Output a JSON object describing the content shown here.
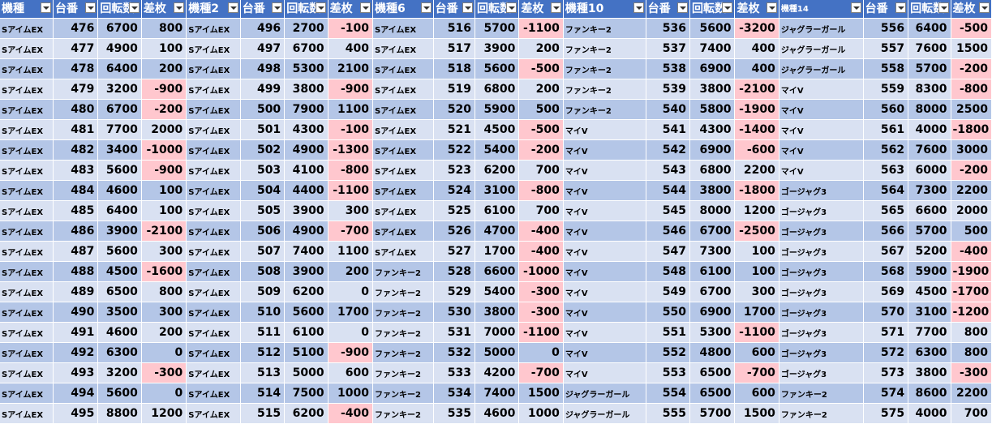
{
  "headers": [
    "機種",
    "台番",
    "回転数",
    "差枚",
    "機種2",
    "台番",
    "回転数",
    "差枚",
    "機種6",
    "台番",
    "回転数",
    "差枚",
    "機種10",
    "台番",
    "回転数",
    "差枚",
    "機種14",
    "台番",
    "回転数",
    "差枚"
  ],
  "header_display": [
    "機種",
    "台番",
    "回転数",
    "差枚",
    "機種2",
    "台番",
    "回転数",
    "差枚",
    "機種6",
    "台番",
    "回転数",
    "差枚",
    "機種10",
    "台番",
    "回転数",
    "差枚",
    "機種14",
    "台番",
    "回転数",
    "差枚"
  ],
  "rows": [
    [
      "SアイムEX",
      "476",
      "6700",
      "800",
      "SアイムEX",
      "496",
      "2700",
      "-100",
      "SアイムEX",
      "516",
      "5700",
      "-1100",
      "ファンキー2",
      "536",
      "5600",
      "-3200",
      "ジャグラーガール",
      "556",
      "6400",
      "-500"
    ],
    [
      "SアイムEX",
      "477",
      "4900",
      "100",
      "SアイムEX",
      "497",
      "6700",
      "400",
      "SアイムEX",
      "517",
      "3900",
      "200",
      "ファンキー2",
      "537",
      "7400",
      "400",
      "ジャグラーガール",
      "557",
      "7600",
      "1500"
    ],
    [
      "SアイムEX",
      "478",
      "6400",
      "200",
      "SアイムEX",
      "498",
      "5300",
      "2100",
      "SアイムEX",
      "518",
      "5600",
      "-500",
      "ファンキー2",
      "538",
      "6900",
      "400",
      "ジャグラーガール",
      "558",
      "5700",
      "-200"
    ],
    [
      "SアイムEX",
      "479",
      "3200",
      "-900",
      "SアイムEX",
      "499",
      "3800",
      "-900",
      "SアイムEX",
      "519",
      "6800",
      "200",
      "ファンキー2",
      "539",
      "3800",
      "-2100",
      "マイV",
      "559",
      "8300",
      "-800"
    ],
    [
      "SアイムEX",
      "480",
      "6700",
      "-200",
      "SアイムEX",
      "500",
      "7900",
      "1100",
      "SアイムEX",
      "520",
      "5900",
      "500",
      "ファンキー2",
      "540",
      "5800",
      "-1900",
      "マイV",
      "560",
      "8000",
      "2500"
    ],
    [
      "SアイムEX",
      "481",
      "7700",
      "2000",
      "SアイムEX",
      "501",
      "4300",
      "-100",
      "SアイムEX",
      "521",
      "4500",
      "-500",
      "マイV",
      "541",
      "4300",
      "-1400",
      "マイV",
      "561",
      "4000",
      "-1800"
    ],
    [
      "SアイムEX",
      "482",
      "3400",
      "-1000",
      "SアイムEX",
      "502",
      "4900",
      "-1300",
      "SアイムEX",
      "522",
      "5400",
      "-200",
      "マイV",
      "542",
      "6900",
      "-600",
      "マイV",
      "562",
      "7600",
      "3000"
    ],
    [
      "SアイムEX",
      "483",
      "5600",
      "-900",
      "SアイムEX",
      "503",
      "4100",
      "-800",
      "SアイムEX",
      "523",
      "6200",
      "700",
      "マイV",
      "543",
      "6800",
      "2200",
      "マイV",
      "563",
      "6000",
      "-200"
    ],
    [
      "SアイムEX",
      "484",
      "4600",
      "100",
      "SアイムEX",
      "504",
      "4400",
      "-1100",
      "SアイムEX",
      "524",
      "3100",
      "-800",
      "マイV",
      "544",
      "3800",
      "-1800",
      "ゴージャグ3",
      "564",
      "7300",
      "2200"
    ],
    [
      "SアイムEX",
      "485",
      "6400",
      "100",
      "SアイムEX",
      "505",
      "3900",
      "300",
      "SアイムEX",
      "525",
      "6100",
      "700",
      "マイV",
      "545",
      "8000",
      "1200",
      "ゴージャグ3",
      "565",
      "6600",
      "2000"
    ],
    [
      "SアイムEX",
      "486",
      "3900",
      "-2100",
      "SアイムEX",
      "506",
      "4900",
      "-700",
      "SアイムEX",
      "526",
      "4700",
      "-400",
      "マイV",
      "546",
      "6700",
      "-2500",
      "ゴージャグ3",
      "566",
      "5700",
      "500"
    ],
    [
      "SアイムEX",
      "487",
      "5600",
      "300",
      "SアイムEX",
      "507",
      "7400",
      "1100",
      "SアイムEX",
      "527",
      "1700",
      "-400",
      "マイV",
      "547",
      "7300",
      "100",
      "ゴージャグ3",
      "567",
      "5200",
      "-400"
    ],
    [
      "SアイムEX",
      "488",
      "4500",
      "-1600",
      "SアイムEX",
      "508",
      "3900",
      "200",
      "ファンキー2",
      "528",
      "6600",
      "-1000",
      "マイV",
      "548",
      "6100",
      "100",
      "ゴージャグ3",
      "568",
      "5900",
      "-1900"
    ],
    [
      "SアイムEX",
      "489",
      "6500",
      "800",
      "SアイムEX",
      "509",
      "6200",
      "0",
      "ファンキー2",
      "529",
      "5400",
      "-300",
      "マイV",
      "549",
      "6700",
      "300",
      "ゴージャグ3",
      "569",
      "4500",
      "-1700"
    ],
    [
      "SアイムEX",
      "490",
      "3500",
      "300",
      "SアイムEX",
      "510",
      "5600",
      "1700",
      "ファンキー2",
      "530",
      "3800",
      "-300",
      "マイV",
      "550",
      "6900",
      "1700",
      "ゴージャグ3",
      "570",
      "3100",
      "-1200"
    ],
    [
      "SアイムEX",
      "491",
      "4600",
      "200",
      "SアイムEX",
      "511",
      "6100",
      "0",
      "ファンキー2",
      "531",
      "7000",
      "-1100",
      "マイV",
      "551",
      "5300",
      "-1100",
      "ゴージャグ3",
      "571",
      "7700",
      "800"
    ],
    [
      "SアイムEX",
      "492",
      "6300",
      "0",
      "SアイムEX",
      "512",
      "5100",
      "-900",
      "ファンキー2",
      "532",
      "5000",
      "0",
      "マイV",
      "552",
      "4800",
      "600",
      "ゴージャグ3",
      "572",
      "6300",
      "800"
    ],
    [
      "SアイムEX",
      "493",
      "3200",
      "-300",
      "SアイムEX",
      "513",
      "5000",
      "600",
      "ファンキー2",
      "533",
      "4200",
      "-700",
      "マイV",
      "553",
      "6500",
      "-700",
      "ゴージャグ3",
      "573",
      "3800",
      "-300"
    ],
    [
      "SアイムEX",
      "494",
      "5600",
      "0",
      "SアイムEX",
      "514",
      "7500",
      "1000",
      "ファンキー2",
      "534",
      "7400",
      "1500",
      "ジャグラーガール",
      "554",
      "6500",
      "600",
      "ファンキー2",
      "574",
      "8600",
      "2200"
    ],
    [
      "SアイムEX",
      "495",
      "8800",
      "1200",
      "SアイムEX",
      "515",
      "6200",
      "-400",
      "ファンキー2",
      "535",
      "4600",
      "1000",
      "ジャグラーガール",
      "555",
      "5700",
      "1500",
      "ファンキー2",
      "575",
      "4000",
      "700"
    ]
  ],
  "colors": {
    "header": "#4472c4",
    "row_dark": "#b4c6e7",
    "row_light": "#d9e1f2",
    "negative_fill": "#ffc7ce",
    "negative_text": "#c00000"
  },
  "icons": {
    "filter": "dropdown-filter-icon"
  }
}
